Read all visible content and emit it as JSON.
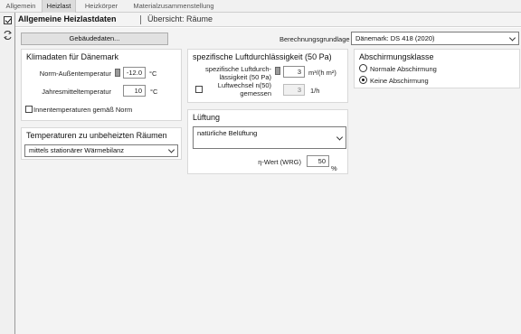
{
  "tabs": [
    "Allgemein",
    "Heizlast",
    "Heizkörper",
    "Materialzusammenstellung"
  ],
  "header": {
    "title": "Allgemeine Heizlastdaten",
    "subtitle": "Übersicht: Räume"
  },
  "toolbar": {
    "gebaeudedaten_label": "Gebäudedaten...",
    "berechnungsgrundlage_label": "Berechnungsgrundlage",
    "berechnungsgrundlage_value": "Dänemark: DS 418 (2020)"
  },
  "klima": {
    "title": "Klimadaten für Dänemark",
    "norm_label": "Norm-Außentemperatur",
    "norm_value": "-12.0",
    "norm_unit": "°C",
    "jahres_label": "Jahresmitteltemperatur",
    "jahres_value": "10",
    "jahres_unit": "°C",
    "innen_label": "Innentemperaturen gemäß Norm"
  },
  "unbeheizt": {
    "title": "Temperaturen zu unbeheizten Räumen",
    "value": "mittels stationärer Wärmebilanz"
  },
  "luftdicht": {
    "title": "spezifische Luftdurchlässigkeit (50 Pa)",
    "spez_label_1": "spezifische Luftdurch-",
    "spez_label_2": "lässigkeit (50 Pa)",
    "spez_value": "3",
    "spez_unit": "m³/(h m²)",
    "lw_label_1": "Luftwechsel n(50)",
    "lw_label_2": "gemessen",
    "lw_value": "3",
    "lw_unit": "1/h"
  },
  "lueftung": {
    "title": "Lüftung",
    "value": "natürliche Belüftung",
    "eta_label": "η-Wert (WRG)",
    "eta_value": "50",
    "eta_unit": "%"
  },
  "abschirmung": {
    "title": "Abschirmungsklasse",
    "opt1": "Normale Abschirmung",
    "opt2": "Keine Abschirmung"
  }
}
